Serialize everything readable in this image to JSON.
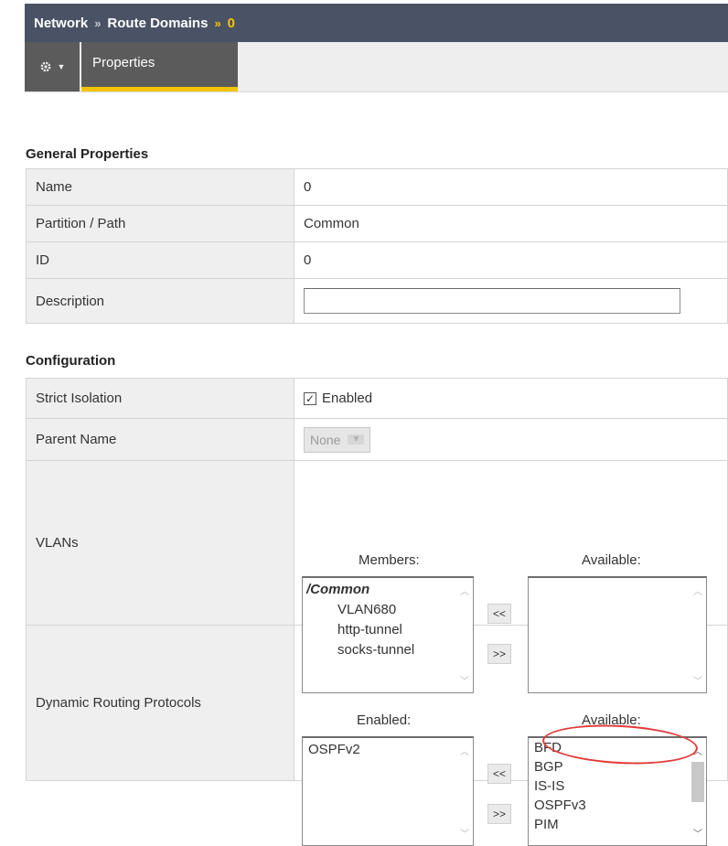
{
  "breadcrumb": {
    "items": [
      "Network",
      "Route Domains"
    ],
    "current": "0",
    "separator": "»"
  },
  "tabs": {
    "menu_icon": "gear-icon",
    "properties_label": "Properties"
  },
  "general": {
    "title": "General Properties",
    "rows": {
      "name": {
        "label": "Name",
        "value": "0"
      },
      "partition": {
        "label": "Partition / Path",
        "value": "Common"
      },
      "id": {
        "label": "ID",
        "value": "0"
      },
      "description": {
        "label": "Description",
        "value": ""
      }
    }
  },
  "configuration": {
    "title": "Configuration",
    "strict_isolation": {
      "label": "Strict Isolation",
      "checked": true,
      "checkbox_label": "Enabled"
    },
    "parent_name": {
      "label": "Parent Name",
      "value": "None"
    },
    "vlans": {
      "label": "VLANs",
      "members_header": "Members:",
      "available_header": "Available:",
      "members": {
        "group": "/Common",
        "items": [
          "VLAN680",
          "http-tunnel",
          "socks-tunnel"
        ]
      },
      "available": [],
      "add_label": "<<",
      "remove_label": ">>"
    },
    "dynamic_routing": {
      "label": "Dynamic Routing Protocols",
      "enabled_header": "Enabled:",
      "available_header": "Available:",
      "enabled": [
        "OSPFv2"
      ],
      "available": [
        "BFD",
        "BGP",
        "IS-IS",
        "OSPFv3",
        "PIM"
      ],
      "add_label": "<<",
      "remove_label": ">>"
    }
  },
  "colors": {
    "topbar": "#4a5266",
    "accent": "#f5c400",
    "annotation": "#e23a3a"
  }
}
